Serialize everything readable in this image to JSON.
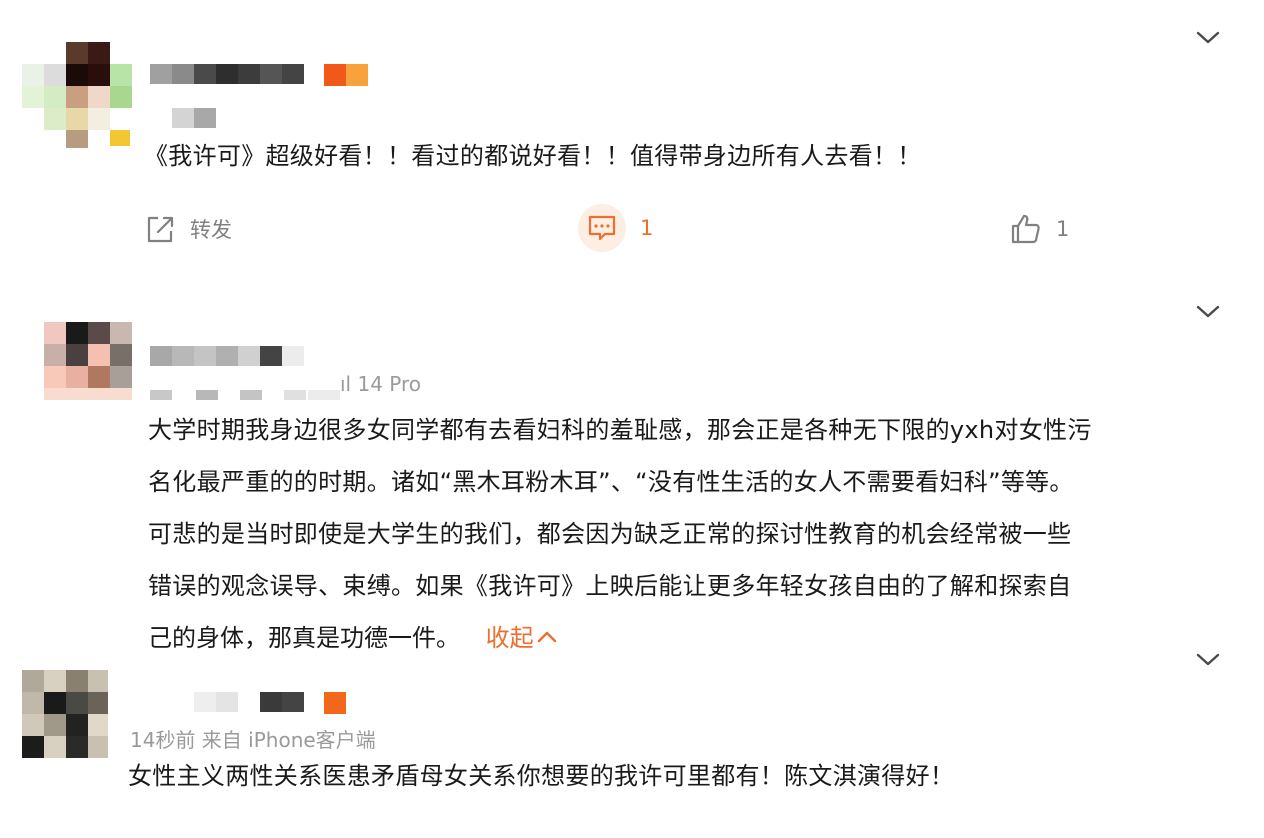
{
  "comments": [
    {
      "text": "《我许可》超级好看！！看过的都说好看！！值得带身边所有人去看！！",
      "actions": {
        "repost_label": "转发",
        "comment_count": "1",
        "like_count": "1"
      }
    },
    {
      "meta": "ıl 14 Pro",
      "lines": [
        "大学时期我身边很多女同学都有去看妇科的羞耻感，那会正是各种无下限的yxh对女性污",
        "名化最严重的的时期。诸如“黑木耳粉木耳”、“没有性生活的女人不需要看妇科”等等。",
        "可悲的是当时即使是大学生的我们，都会因为缺乏正常的探讨性教育的机会经常被一些",
        "错误的观念误导、束缚。如果《我许可》上映后能让更多年轻女孩自由的了解和探索自",
        "己的身体，那真是功德一件。"
      ],
      "collapse_label": "收起"
    },
    {
      "meta": "14秒前  来自 iPhone客户端",
      "text": "女性主义两性关系医患矛盾母女关系你想要的我许可里都有！陈文淇演得好！"
    }
  ],
  "colors": {
    "accent": "#ee6e2e",
    "muted": "#808080"
  }
}
